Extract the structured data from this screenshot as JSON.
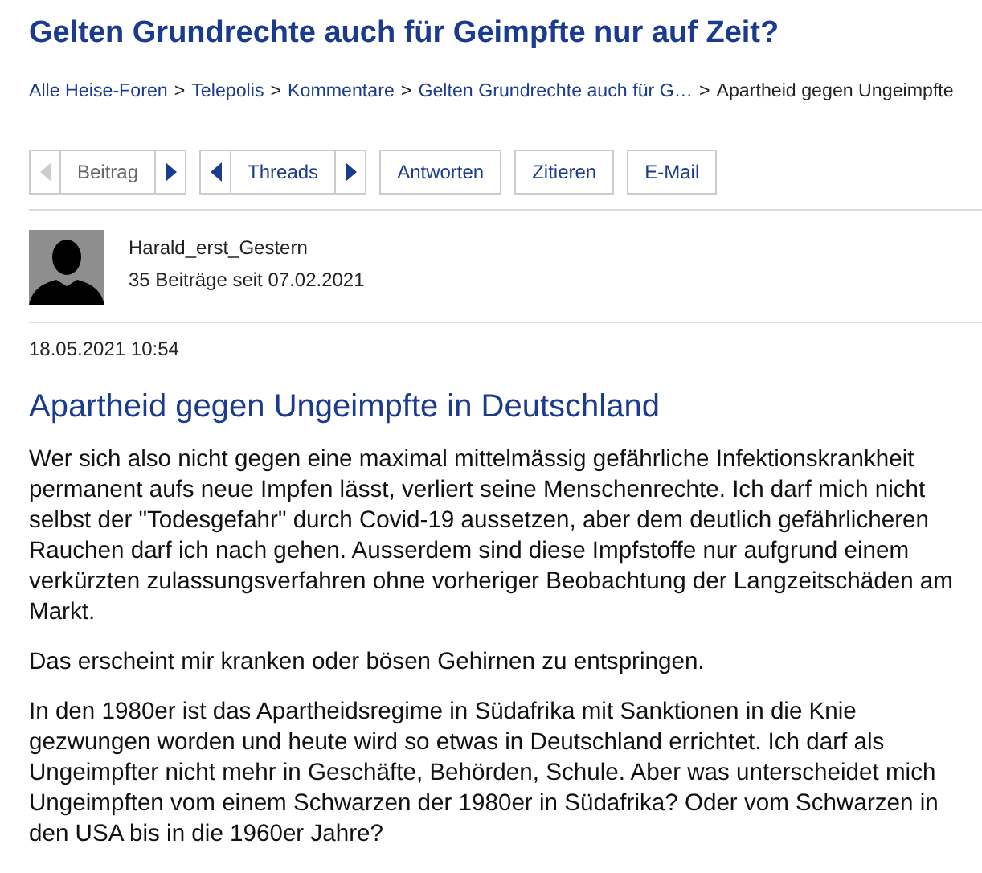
{
  "page_title": "Gelten Grundrechte auch für Geimpfte nur auf Zeit?",
  "breadcrumb": [
    {
      "label": "Alle Heise-Foren",
      "link": true
    },
    {
      "label": "Telepolis",
      "link": true
    },
    {
      "label": "Kommentare",
      "link": true
    },
    {
      "label": "Gelten Grundrechte auch für G…",
      "link": true
    },
    {
      "label": "Apartheid gegen Ungeimpfte",
      "link": false
    }
  ],
  "breadcrumb_separator": ">",
  "nav_groups": [
    {
      "label": "Beitrag",
      "disabled": true,
      "prev_disabled": true,
      "next_disabled": false
    },
    {
      "label": "Threads",
      "disabled": false,
      "prev_disabled": false,
      "next_disabled": false
    }
  ],
  "actions": [
    "Antworten",
    "Zitieren",
    "E-Mail"
  ],
  "author": {
    "name": "Harald_erst_Gestern",
    "posts": "35 Beiträge seit 07.02.2021"
  },
  "date": "18.05.2021 10:54",
  "post_title": "Apartheid gegen Ungeimpfte in Deutschland",
  "paragraphs": [
    "Wer sich also nicht gegen eine maximal mittelmässig gefährliche Infektionskrankheit permanent aufs neue Impfen lässt, verliert seine Menschenrechte. Ich darf mich nicht selbst der \"Todesgefahr\" durch Covid-19 aussetzen, aber dem deutlich gefährlicheren Rauchen darf ich nach gehen. Ausserdem sind diese Impfstoffe nur aufgrund einem verkürzten zulassungsverfahren ohne vorheriger Beobachtung der Langzeitschäden am Markt.",
    "Das erscheint mir kranken oder bösen Gehirnen zu entspringen.",
    "In den 1980er ist das Apartheidsregime in Südafrika mit Sanktionen in die Knie gezwungen worden und heute wird so etwas in Deutschland errichtet. Ich darf als Ungeimpfter nicht mehr in Geschäfte, Behörden, Schule. Aber was unterscheidet mich Ungeimpften vom einem Schwarzen der 1980er in Südafrika? Oder vom Schwarzen in den USA bis in die 1960er Jahre?"
  ]
}
